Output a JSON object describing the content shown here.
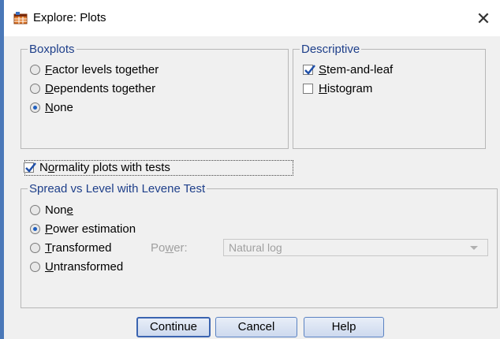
{
  "window": {
    "title": "Explore: Plots",
    "close_glyph": "✕",
    "icon": "spss-table-icon"
  },
  "boxplots": {
    "legend": "Boxplots",
    "options": [
      {
        "pre": "",
        "u": "F",
        "post": "actor levels together",
        "selected": false
      },
      {
        "pre": "",
        "u": "D",
        "post": "ependents together",
        "selected": false
      },
      {
        "pre": "",
        "u": "N",
        "post": "one",
        "selected": true
      }
    ]
  },
  "descriptive": {
    "legend": "Descriptive",
    "stem": {
      "pre": "",
      "u": "S",
      "post": "tem-and-leaf",
      "checked": true
    },
    "histogram": {
      "pre": "",
      "u": "H",
      "post": "istogram",
      "checked": false
    }
  },
  "normality": {
    "pre": "N",
    "u": "o",
    "post": "rmality plots with tests",
    "checked": true
  },
  "spread": {
    "legend": "Spread vs Level with Levene Test",
    "none": {
      "pre": "Non",
      "u": "e",
      "post": "",
      "selected": false
    },
    "power_est": {
      "pre": "",
      "u": "P",
      "post": "ower estimation",
      "selected": true
    },
    "transformed": {
      "pre": "",
      "u": "T",
      "post": "ransformed",
      "selected": false
    },
    "power_label": {
      "pre": "Po",
      "u": "w",
      "post": "er:"
    },
    "power_value": "Natural log",
    "untransformed": {
      "pre": "",
      "u": "U",
      "post": "ntransformed",
      "selected": false
    }
  },
  "buttons": {
    "continue": "Continue",
    "cancel": "Cancel",
    "help": "Help"
  },
  "colors": {
    "legend_text": "#1e3f8a",
    "accent": "#1f5fbf",
    "disabled_text": "#a0a0a0"
  }
}
